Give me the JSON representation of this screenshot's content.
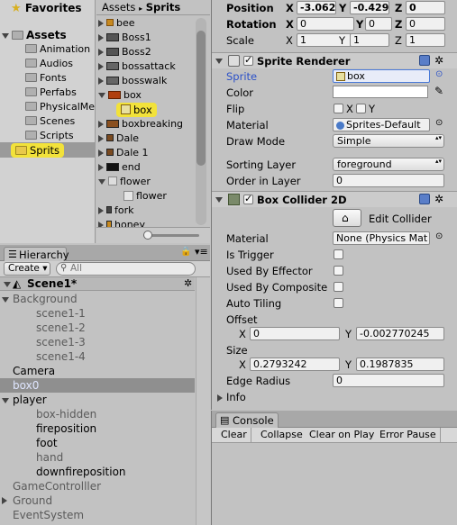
{
  "project": {
    "favorites_label": "Favorites",
    "assets_label": "Assets",
    "folders": [
      "Animation",
      "Audios",
      "Fonts",
      "Perfabs",
      "PhysicalMe",
      "Scenes",
      "Scripts",
      "Sprits"
    ],
    "breadcrumb": {
      "root": "Assets",
      "sep": "▸",
      "current": "Sprits"
    },
    "files": [
      "bee",
      "Boss1",
      "Boss2",
      "bossattack",
      "bosswalk",
      "box",
      "box",
      "boxbreaking",
      "Dale",
      "Dale 1",
      "end",
      "flower",
      "flower",
      "fork",
      "honey"
    ]
  },
  "hierarchy": {
    "tab_label": "Hierarchy",
    "create_label": "Create ▾",
    "search_placeholder": "All",
    "scene": "Scene1*",
    "items": [
      {
        "label": "Background",
        "indent": 1,
        "expand": "down",
        "style": "grey"
      },
      {
        "label": "scene1-1",
        "indent": 2,
        "style": "grey"
      },
      {
        "label": "scene1-2",
        "indent": 2,
        "style": "grey"
      },
      {
        "label": "scene1-3",
        "indent": 2,
        "style": "grey"
      },
      {
        "label": "scene1-4",
        "indent": 2,
        "style": "grey"
      },
      {
        "label": "Camera",
        "indent": 1,
        "style": "normal"
      },
      {
        "label": "box0",
        "indent": 1,
        "style": "selected"
      },
      {
        "label": "player",
        "indent": 1,
        "expand": "down",
        "style": "normal"
      },
      {
        "label": "box-hidden",
        "indent": 2,
        "style": "grey"
      },
      {
        "label": "fireposition",
        "indent": 2,
        "style": "normal"
      },
      {
        "label": "foot",
        "indent": 2,
        "style": "normal"
      },
      {
        "label": "hand",
        "indent": 2,
        "style": "grey"
      },
      {
        "label": "downfireposition",
        "indent": 2,
        "style": "normal"
      },
      {
        "label": "GameControlller",
        "indent": 1,
        "style": "grey"
      },
      {
        "label": "Ground",
        "indent": 1,
        "expand": "right",
        "style": "grey"
      },
      {
        "label": "EventSystem",
        "indent": 1,
        "style": "grey"
      }
    ]
  },
  "inspector": {
    "transform": {
      "position_label": "Position",
      "rotation_label": "Rotation",
      "scale_label": "Scale",
      "x": "X",
      "y": "Y",
      "z": "Z",
      "position": [
        "-3.062",
        "-0.429",
        "0"
      ],
      "rotation": [
        "0",
        "0",
        "0"
      ],
      "scale": [
        "1",
        "1",
        "1"
      ]
    },
    "sprite_renderer": {
      "title": "Sprite Renderer",
      "sprite_label": "Sprite",
      "sprite_value": "box",
      "color_label": "Color",
      "flip_label": "Flip",
      "flip_x": "X",
      "flip_y": "Y",
      "material_label": "Material",
      "material_value": "Sprites-Default",
      "draw_mode_label": "Draw Mode",
      "draw_mode_value": "Simple",
      "sorting_layer_label": "Sorting Layer",
      "sorting_layer_value": "foreground",
      "order_label": "Order in Layer",
      "order_value": "0"
    },
    "box_collider": {
      "title": "Box Collider 2D",
      "edit_label": "Edit Collider",
      "material_label": "Material",
      "material_value": "None (Physics Mat",
      "is_trigger_label": "Is Trigger",
      "used_by_effector_label": "Used By Effector",
      "used_by_composite_label": "Used By Composite",
      "auto_tiling_label": "Auto Tiling",
      "offset_label": "Offset",
      "offset_x": "0",
      "offset_y": "-0.002770245",
      "size_label": "Size",
      "size_x": "0.2793242",
      "size_y": "0.1987835",
      "edge_radius_label": "Edge Radius",
      "edge_radius_value": "0",
      "info_label": "Info"
    }
  },
  "console": {
    "tab_label": "Console",
    "buttons": [
      "Clear",
      "Collapse",
      "Clear on Play",
      "Error Pause"
    ]
  }
}
